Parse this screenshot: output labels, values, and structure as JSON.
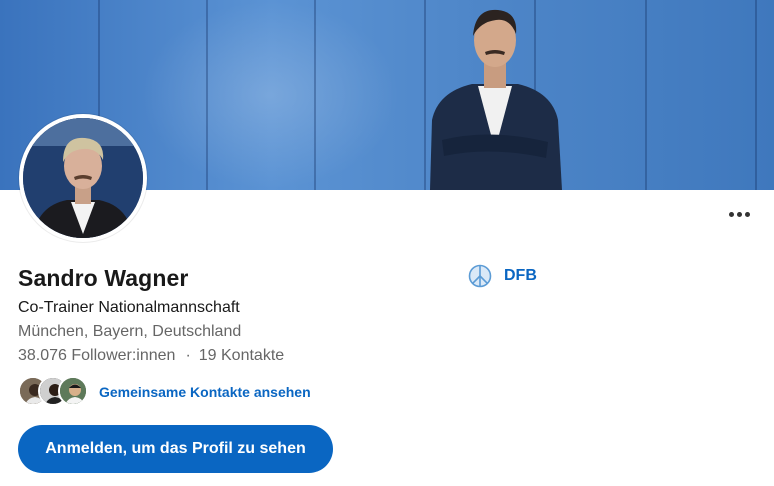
{
  "banner": {
    "image": "cover-photo-man-blue-wall"
  },
  "avatar": {
    "image": "profile-photo"
  },
  "profile": {
    "name": "Sandro Wagner",
    "headline": "Co-Trainer Nationalmannschaft",
    "location": "München, Bayern, Deutschland",
    "followers": "38.076 Follower:innen",
    "separator": "·",
    "connections": "19 Kontakte"
  },
  "company": {
    "name": "DFB",
    "logo_icon": "peace-icon"
  },
  "mutual": {
    "label": "Gemeinsame Kontakte ansehen"
  },
  "actions": {
    "signin_label": "Anmelden, um das Profil zu sehen",
    "more_icon": "ellipsis-icon"
  },
  "colors": {
    "accent": "#0a66c2",
    "text": "#191919",
    "muted": "#666666",
    "banner": "#4f87c9"
  }
}
